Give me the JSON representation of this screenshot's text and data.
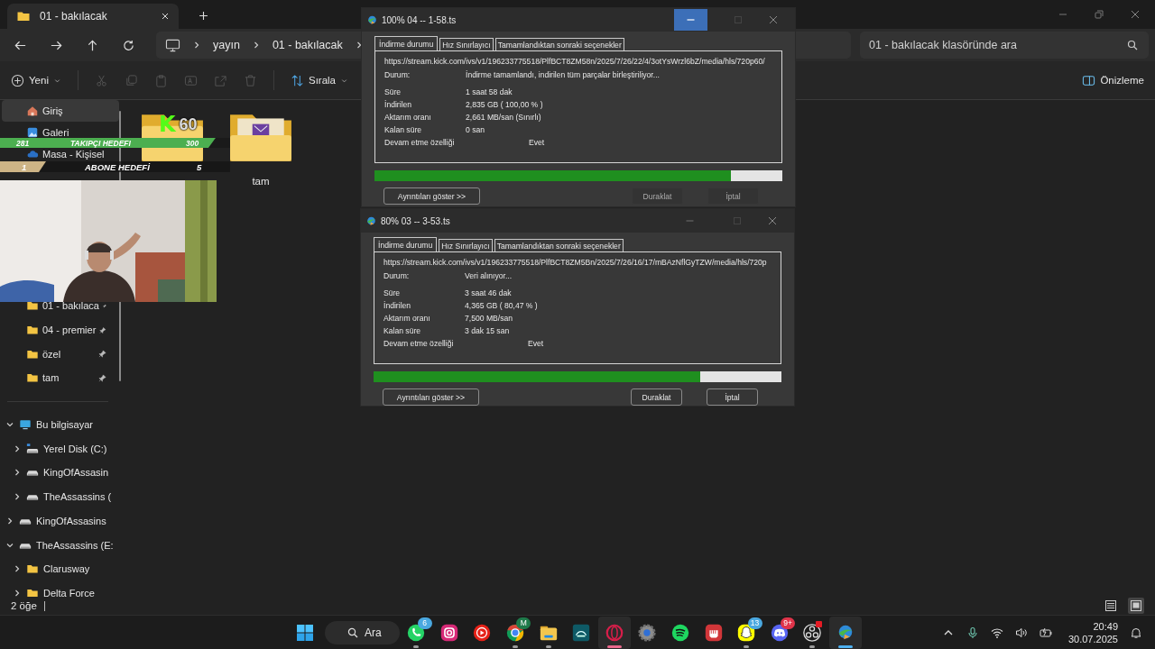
{
  "explorer": {
    "tab_title": "01 - bakılacak",
    "breadcrumb": [
      "yayın",
      "01 - bakılacak"
    ],
    "search": {
      "placeholder": "01 - bakılacak klasöründe ara"
    },
    "new_button": "Yeni",
    "sort_button": "Sırala",
    "preview_button": "Önizleme",
    "sidebar": {
      "quick": [
        {
          "label": "Giriş",
          "kind": "home",
          "selected": true,
          "pinned": false
        },
        {
          "label": "Galeri",
          "kind": "gallery",
          "selected": false,
          "pinned": false
        },
        {
          "label": "Masa - Kişisel",
          "kind": "cloud",
          "selected": false,
          "pinned": false
        }
      ],
      "pinned": [
        {
          "label": "01 - bakılaca",
          "kind": "folder",
          "selected": false,
          "pinned": true
        },
        {
          "label": "04 - premier",
          "kind": "folder",
          "selected": false,
          "pinned": true
        },
        {
          "label": "özel",
          "kind": "folder",
          "selected": false,
          "pinned": true
        },
        {
          "label": "tam",
          "kind": "folder",
          "selected": false,
          "pinned": true
        }
      ],
      "tree": [
        {
          "label": "Bu bilgisayar",
          "kind": "computer",
          "expanded": true,
          "children": [
            {
              "label": "Yerel Disk (C:)",
              "kind": "system-drive",
              "expanded": false
            },
            {
              "label": "KingOfAssasin",
              "kind": "drive",
              "expanded": false
            },
            {
              "label": "TheAssassins (",
              "kind": "drive",
              "expanded": false
            }
          ]
        },
        {
          "label": "KingOfAssasins",
          "kind": "drive",
          "expanded": false
        },
        {
          "label": "TheAssassins (E:",
          "kind": "drive",
          "expanded": true,
          "children": [
            {
              "label": "Clarusway",
              "kind": "folder",
              "expanded": false
            },
            {
              "label": "Delta Force",
              "kind": "folder",
              "expanded": false
            }
          ]
        }
      ]
    },
    "files": [
      {
        "kind": "folder"
      },
      {
        "kind": "folder-with-file",
        "name": "tam"
      }
    ],
    "status": "2 öğe",
    "view_modes": [
      {
        "kind": "details",
        "selected": false
      },
      {
        "kind": "tiles",
        "selected": true
      }
    ]
  },
  "downloads": [
    {
      "title": "100% 04 -- 1-58.ts",
      "minimize_hovered": true,
      "tabs": [
        {
          "label": "İndirme durumu",
          "selected": true
        },
        {
          "label": "Hız Sınırlayıcı",
          "selected": false
        },
        {
          "label": "Tamamlandıktan sonraki seçenekler",
          "selected": false
        }
      ],
      "url": "https://stream.kick.com/ivs/v1/196233775518/PlfBCT8ZM58n/2025/7/26/22/4/3otYsWrzl6bZ/media/hls/720p60/",
      "status_label": "Durum:",
      "status": "İndirme tamamlandı, indirilen tüm parçalar birleştiriliyor...",
      "fields": [
        {
          "label": "Süre",
          "value": "1 saat 58 dak"
        },
        {
          "label": "İndirilen",
          "value": "2,835  GB  ( 100,00 % )"
        },
        {
          "label": "Aktarım oranı",
          "value": "2,661  MB/san  (Sınırlı)"
        },
        {
          "label": "Kalan süre",
          "value": "0 san"
        }
      ],
      "resume": {
        "label": "Devam etme özelliği",
        "value": "Evet"
      },
      "level": 0.874,
      "buttons": [
        {
          "label": "Ayrıntıları göster >>",
          "disabled": false
        },
        {
          "label": "Duraklat",
          "disabled": true
        },
        {
          "label": "İptal",
          "disabled": true
        }
      ]
    },
    {
      "title": "80% 03 -- 3-53.ts",
      "minimize_hovered": false,
      "tabs": [
        {
          "label": "İndirme durumu",
          "selected": true
        },
        {
          "label": "Hız Sınırlayıcı",
          "selected": false
        },
        {
          "label": "Tamamlandıktan sonraki seçenekler",
          "selected": false
        }
      ],
      "url": "https://stream.kick.com/ivs/v1/196233775518/PlfBCT8ZM5Bn/2025/7/26/16/17/mBAzNflGyTZW/media/hls/720p",
      "status_label": "Durum:",
      "status": "Veri alınıyor...",
      "fields": [
        {
          "label": "Süre",
          "value": "3 saat 46 dak"
        },
        {
          "label": "İndirilen",
          "value": "4,365  GB  ( 80,47 % )"
        },
        {
          "label": "Aktarım oranı",
          "value": "7,500  MB/san"
        },
        {
          "label": "Kalan süre",
          "value": "3 dak 15 san"
        }
      ],
      "resume": {
        "label": "Devam etme özelliği",
        "value": "Evet"
      },
      "level": 0.8,
      "buttons": [
        {
          "label": "Ayrıntıları göster >>",
          "disabled": false
        },
        {
          "label": "Duraklat",
          "disabled": false
        },
        {
          "label": "İptal",
          "disabled": false
        }
      ]
    }
  ],
  "overlay": {
    "follower_goal": {
      "current": "281",
      "label": "TAKIPÇI HEDEFI",
      "target": "300",
      "level": 0.937
    },
    "sub_goal": {
      "current": "1",
      "label": "ABONE HEDEFİ",
      "target": "5",
      "level": 0.2
    },
    "kick_badge": {
      "logo": "K",
      "count": "60"
    }
  },
  "taskbar": {
    "search": "Ara",
    "apps": [
      {
        "running": true,
        "active": false,
        "badge": "6",
        "color": "#4aa8e0"
      },
      {
        "running": false,
        "active": false
      },
      {
        "running": false,
        "active": false
      },
      {
        "running": true,
        "active": false,
        "badge": "M",
        "color": "#1e7a4a"
      },
      {
        "running": true,
        "active": false
      },
      {
        "running": false,
        "active": false
      },
      {
        "running": true,
        "active": true
      },
      {
        "running": false,
        "active": false
      },
      {
        "running": false,
        "active": false
      },
      {
        "running": false,
        "active": false
      },
      {
        "running": true,
        "active": false,
        "badge": "13",
        "color": "#4aa8e0"
      },
      {
        "running": false,
        "active": false,
        "badge": "9+",
        "color": "#e0344a"
      },
      {
        "running": true,
        "active": false,
        "alert": true
      },
      {
        "running": true,
        "active": true
      }
    ],
    "time": "20:49",
    "date": "30.07.2025"
  }
}
